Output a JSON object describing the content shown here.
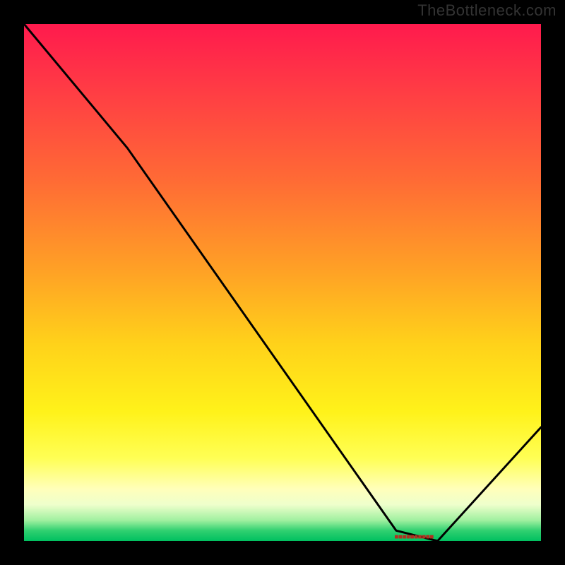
{
  "watermark": "TheBottleneck.com",
  "marker_label": "■■■■■■■■■■",
  "colors": {
    "line": "#000000",
    "marker_text": "#b03020"
  },
  "chart_data": {
    "type": "line",
    "title": "",
    "xlabel": "",
    "ylabel": "",
    "xlim": [
      0,
      100
    ],
    "ylim": [
      0,
      100
    ],
    "x": [
      0,
      20,
      72,
      80,
      100
    ],
    "values": [
      100,
      76,
      2,
      0,
      22
    ],
    "grid": false,
    "legend": false,
    "annotations": [
      {
        "text": "■■■■■■■■■■",
        "x": 76,
        "y": 1
      }
    ],
    "background": "vertical-gradient red→orange→yellow→pale→green (bottleneck-style heat ramp)"
  }
}
